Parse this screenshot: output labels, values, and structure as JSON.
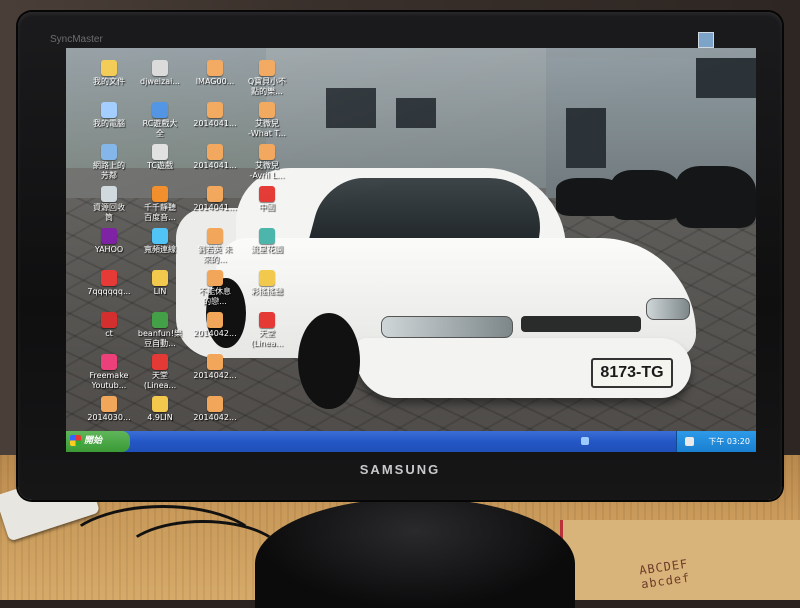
{
  "monitor": {
    "brand": "SAMSUNG",
    "bezel_model": "SyncMaster"
  },
  "car": {
    "plate": "8173-TG",
    "color": "#f4f5f3"
  },
  "desktop_icons": [
    {
      "label": "我的文件",
      "color": "#f2c94c"
    },
    {
      "label": "djweizai...",
      "color": "#d9d9d9"
    },
    {
      "label": "IMAG00...",
      "color": "#f2a65a"
    },
    {
      "label": "Q寶貝小不\n點的樂...",
      "color": "#f2a65a"
    },
    {
      "label": "我的電腦",
      "color": "#9ecbff"
    },
    {
      "label": "RC遊戲大\n全",
      "color": "#4a90e2"
    },
    {
      "label": "2014041...",
      "color": "#f2a65a"
    },
    {
      "label": "艾微兒\n-What T...",
      "color": "#f2a65a"
    },
    {
      "label": "網路上的\n芳鄰",
      "color": "#7fb3e8"
    },
    {
      "label": "TC遊戲",
      "color": "#e0e0e0"
    },
    {
      "label": "2014041...",
      "color": "#f2a65a"
    },
    {
      "label": "艾微兒\n-Avril L...",
      "color": "#f2a65a"
    },
    {
      "label": "資源回收\n筒",
      "color": "#cfd8dc"
    },
    {
      "label": "千千靜聽\n百度音...",
      "color": "#f28c28"
    },
    {
      "label": "2014041...",
      "color": "#f2a65a"
    },
    {
      "label": "中國",
      "color": "#e53935"
    },
    {
      "label": "YAHOO",
      "color": "#7b1fa2"
    },
    {
      "label": "寬頻連線",
      "color": "#4fc3f7"
    },
    {
      "label": "劉若英 未\n來的... ",
      "color": "#f2a65a"
    },
    {
      "label": "流星花園",
      "color": "#4db6ac"
    },
    {
      "label": "7qqqqqq...",
      "color": "#e53935"
    },
    {
      "label": "LIN",
      "color": "#f2c94c"
    },
    {
      "label": "不能休息\n的戀...",
      "color": "#f2a65a"
    },
    {
      "label": "彩搖搖聽",
      "color": "#f2c94c"
    },
    {
      "label": "ct",
      "color": "#d32f2f"
    },
    {
      "label": "beanfun!樂\n豆自動...",
      "color": "#43a047"
    },
    {
      "label": "2014042...",
      "color": "#f2a65a"
    },
    {
      "label": "天堂\n(Linea...",
      "color": "#e53935"
    },
    {
      "label": "Freemake\nYoutub...",
      "color": "#ec407a"
    },
    {
      "label": "天堂\n(Linea...",
      "color": "#e53935"
    },
    {
      "label": "2014042...",
      "color": "#f2a65a"
    },
    {
      "label": "",
      "color": "transparent"
    },
    {
      "label": "2014030...",
      "color": "#f2a65a"
    },
    {
      "label": "4.9LIN",
      "color": "#f2c94c"
    },
    {
      "label": "2014042...",
      "color": "#f2a65a"
    }
  ],
  "taskbar": {
    "start_label": "開始",
    "clock": "下午 03:20"
  },
  "desk_mat": {
    "line1": "ABCDEF",
    "line2": "abcdef"
  }
}
